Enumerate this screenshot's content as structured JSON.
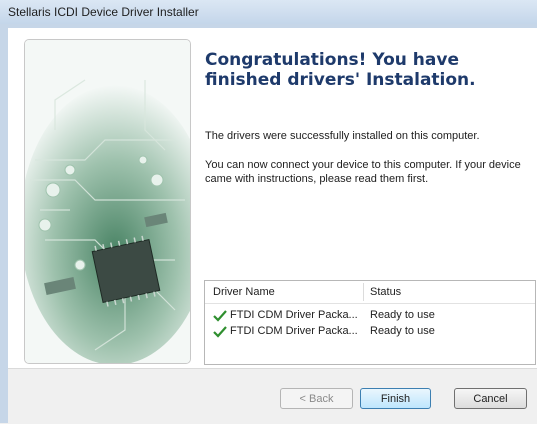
{
  "window": {
    "title": "Stellaris ICDI Device Driver Installer"
  },
  "main": {
    "heading": "Congratulations! You have finished drivers' Instalation.",
    "message1": "The drivers were successfully installed on this computer.",
    "message2": "You can now connect your device to this computer. If your device came with instructions, please read them first."
  },
  "driver_list": {
    "columns": [
      "Driver Name",
      "Status"
    ],
    "rows": [
      {
        "icon": "check-icon",
        "name": "FTDI CDM Driver Packa...",
        "status": "Ready to use"
      },
      {
        "icon": "check-icon",
        "name": "FTDI CDM Driver Packa...",
        "status": "Ready to use"
      }
    ]
  },
  "buttons": {
    "back": "< Back",
    "finish": "Finish",
    "cancel": "Cancel"
  },
  "colors": {
    "heading": "#1e3a6b",
    "check": "#2f8f2f",
    "titlebar": "#c4d6ea"
  }
}
